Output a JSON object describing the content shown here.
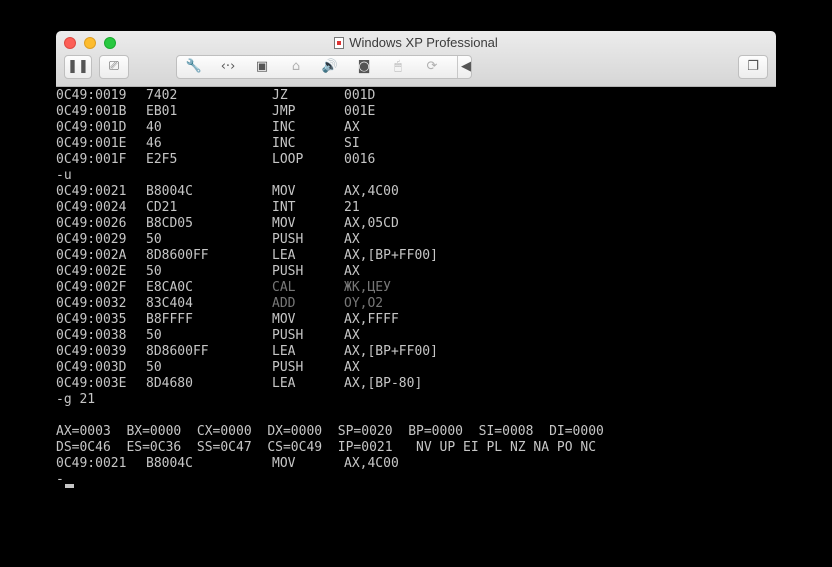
{
  "window": {
    "title": "Windows XP Professional"
  },
  "toolbar": {
    "pause_glyph": "❚❚",
    "snapshot_glyph": "⎚",
    "restore_glyph": "❐",
    "devices": [
      {
        "name": "settings-wrench-icon",
        "glyph": "🔧",
        "dim": false
      },
      {
        "name": "network-arrows-icon",
        "glyph": "‹·›",
        "dim": false
      },
      {
        "name": "hard-disk-icon",
        "glyph": "▣",
        "dim": false
      },
      {
        "name": "printer-icon",
        "glyph": "⌂",
        "dim": true
      },
      {
        "name": "sound-icon",
        "glyph": "🔊",
        "dim": false
      },
      {
        "name": "cd-drive-icon",
        "glyph": "◙",
        "dim": false
      },
      {
        "name": "usb-mouse-icon",
        "glyph": "🖱",
        "dim": true
      },
      {
        "name": "shared-folder-icon",
        "glyph": "⟳",
        "dim": true
      },
      {
        "name": "collapse-arrow-icon",
        "glyph": "◀",
        "dim": false
      }
    ]
  },
  "console": {
    "lines": [
      {
        "type": "asm",
        "addr": "0C49:0019",
        "hex": "7402",
        "mn": "JZ",
        "op": "001D"
      },
      {
        "type": "asm",
        "addr": "0C49:001B",
        "hex": "EB01",
        "mn": "JMP",
        "op": "001E"
      },
      {
        "type": "asm",
        "addr": "0C49:001D",
        "hex": "40",
        "mn": "INC",
        "op": "AX"
      },
      {
        "type": "asm",
        "addr": "0C49:001E",
        "hex": "46",
        "mn": "INC",
        "op": "SI"
      },
      {
        "type": "asm",
        "addr": "0C49:001F",
        "hex": "E2F5",
        "mn": "LOOP",
        "op": "0016"
      },
      {
        "type": "text",
        "text": "-u"
      },
      {
        "type": "asm",
        "addr": "0C49:0021",
        "hex": "B8004C",
        "mn": "MOV",
        "op": "AX,4C00"
      },
      {
        "type": "asm",
        "addr": "0C49:0024",
        "hex": "CD21",
        "mn": "INT",
        "op": "21"
      },
      {
        "type": "asm",
        "addr": "0C49:0026",
        "hex": "B8CD05",
        "mn": "MOV",
        "op": "AX,05CD"
      },
      {
        "type": "asm",
        "addr": "0C49:0029",
        "hex": "50",
        "mn": "PUSH",
        "op": "AX"
      },
      {
        "type": "asm",
        "addr": "0C49:002A",
        "hex": "8D8600FF",
        "mn": "LEA",
        "op": "AX,[BP+FF00]"
      },
      {
        "type": "asm",
        "addr": "0C49:002E",
        "hex": "50",
        "mn": "PUSH",
        "op": "AX"
      },
      {
        "type": "asm",
        "addr": "0C49:002F",
        "hex": "E8CA0C",
        "mn": "CAL",
        "op": "ЖК,ЦЕУ",
        "glitch": true
      },
      {
        "type": "asm",
        "addr": "0C49:0032",
        "hex": "83C404",
        "mn": "ADD",
        "op": "OY,O2",
        "glitch": true
      },
      {
        "type": "asm",
        "addr": "0C49:0035",
        "hex": "B8FFFF",
        "mn": "MOV",
        "op": "AX,FFFF"
      },
      {
        "type": "asm",
        "addr": "0C49:0038",
        "hex": "50",
        "mn": "PUSH",
        "op": "AX"
      },
      {
        "type": "asm",
        "addr": "0C49:0039",
        "hex": "8D8600FF",
        "mn": "LEA",
        "op": "AX,[BP+FF00]"
      },
      {
        "type": "asm",
        "addr": "0C49:003D",
        "hex": "50",
        "mn": "PUSH",
        "op": "AX"
      },
      {
        "type": "asm",
        "addr": "0C49:003E",
        "hex": "8D4680",
        "mn": "LEA",
        "op": "AX,[BP-80]"
      },
      {
        "type": "text",
        "text": "-g 21"
      },
      {
        "type": "text",
        "text": ""
      },
      {
        "type": "text",
        "text": "AX=0003  BX=0000  CX=0000  DX=0000  SP=0020  BP=0000  SI=0008  DI=0000"
      },
      {
        "type": "text",
        "text": "DS=0C46  ES=0C36  SS=0C47  CS=0C49  IP=0021   NV UP EI PL NZ NA PO NC"
      },
      {
        "type": "asm",
        "addr": "0C49:0021",
        "hex": "B8004C",
        "mn": "MOV",
        "op": "AX,4C00"
      },
      {
        "type": "text",
        "text": "-"
      }
    ]
  }
}
